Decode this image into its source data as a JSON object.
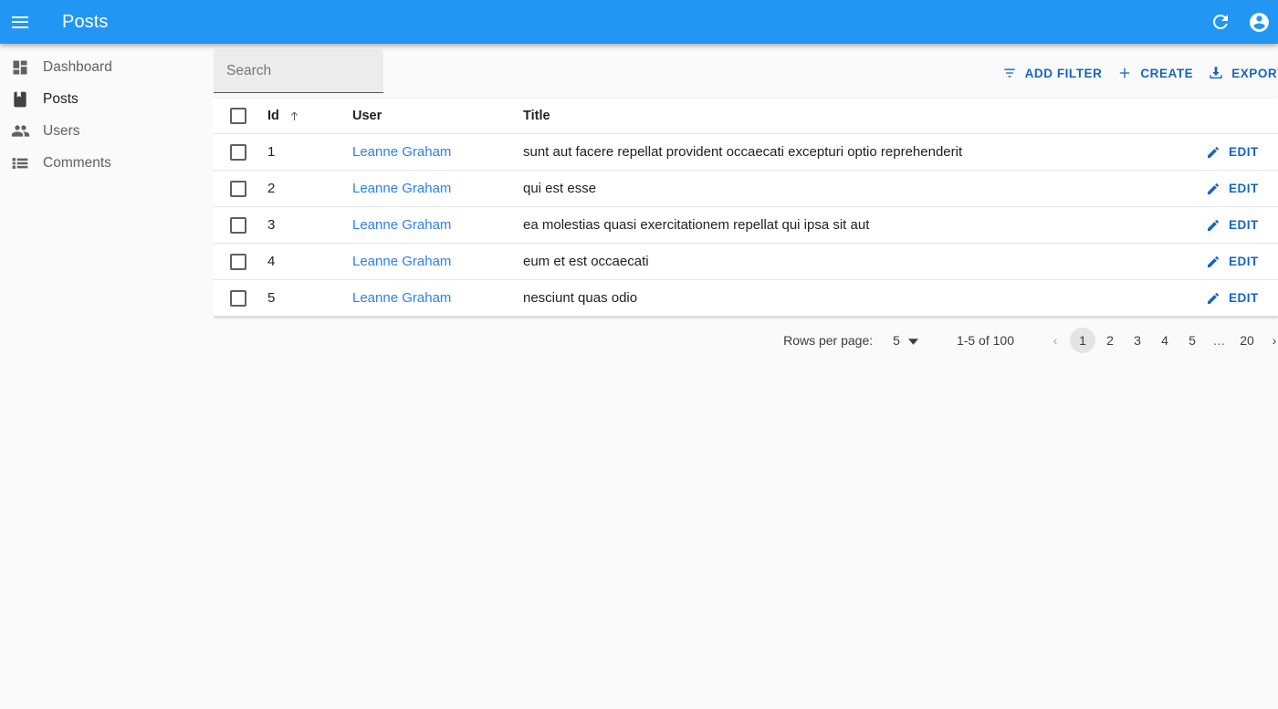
{
  "appbar": {
    "title": "Posts",
    "menu_icon": "hamburger-menu-icon",
    "refresh_icon": "refresh-icon",
    "account_icon": "account-circle-icon",
    "background_color": "#2196f3"
  },
  "sidebar": {
    "items": [
      {
        "label": "Dashboard",
        "icon": "dashboard-icon",
        "active": false
      },
      {
        "label": "Posts",
        "icon": "book-icon",
        "active": true
      },
      {
        "label": "Users",
        "icon": "people-icon",
        "active": false
      },
      {
        "label": "Comments",
        "icon": "list-icon",
        "active": false
      }
    ]
  },
  "toolbar": {
    "search": {
      "value": "",
      "placeholder": "Search"
    },
    "add_filter_label": "ADD FILTER",
    "create_label": "CREATE",
    "export_label": "EXPORT",
    "add_filter_icon": "filter-list-icon",
    "create_icon": "plus-icon",
    "export_icon": "download-icon",
    "accent_color": "#1565c0"
  },
  "table": {
    "columns": [
      {
        "key": "check",
        "label": ""
      },
      {
        "key": "id",
        "label": "Id",
        "sorted": "asc",
        "sort_icon": "arrow-upward-icon"
      },
      {
        "key": "user",
        "label": "User"
      },
      {
        "key": "title",
        "label": "Title"
      },
      {
        "key": "action",
        "label": ""
      }
    ],
    "rows": [
      {
        "id": "1",
        "user": "Leanne Graham",
        "title": "sunt aut facere repellat provident occaecati excepturi optio reprehenderit",
        "action": "EDIT",
        "checked": false
      },
      {
        "id": "2",
        "user": "Leanne Graham",
        "title": "qui est esse",
        "action": "EDIT",
        "checked": false
      },
      {
        "id": "3",
        "user": "Leanne Graham",
        "title": "ea molestias quasi exercitationem repellat qui ipsa sit aut",
        "action": "EDIT",
        "checked": false
      },
      {
        "id": "4",
        "user": "Leanne Graham",
        "title": "eum et est occaecati",
        "action": "EDIT",
        "checked": false
      },
      {
        "id": "5",
        "user": "Leanne Graham",
        "title": "nesciunt quas odio",
        "action": "EDIT",
        "checked": false
      }
    ],
    "link_color": "#2d7ff0"
  },
  "pagination": {
    "rows_per_page_label": "Rows per page:",
    "rows_per_page_value": "5",
    "range_label": "1-5 of 100",
    "prev_label": "‹",
    "next_label": "›",
    "pages": [
      "1",
      "2",
      "3",
      "4",
      "5",
      "…",
      "20"
    ],
    "current_page": "1"
  }
}
